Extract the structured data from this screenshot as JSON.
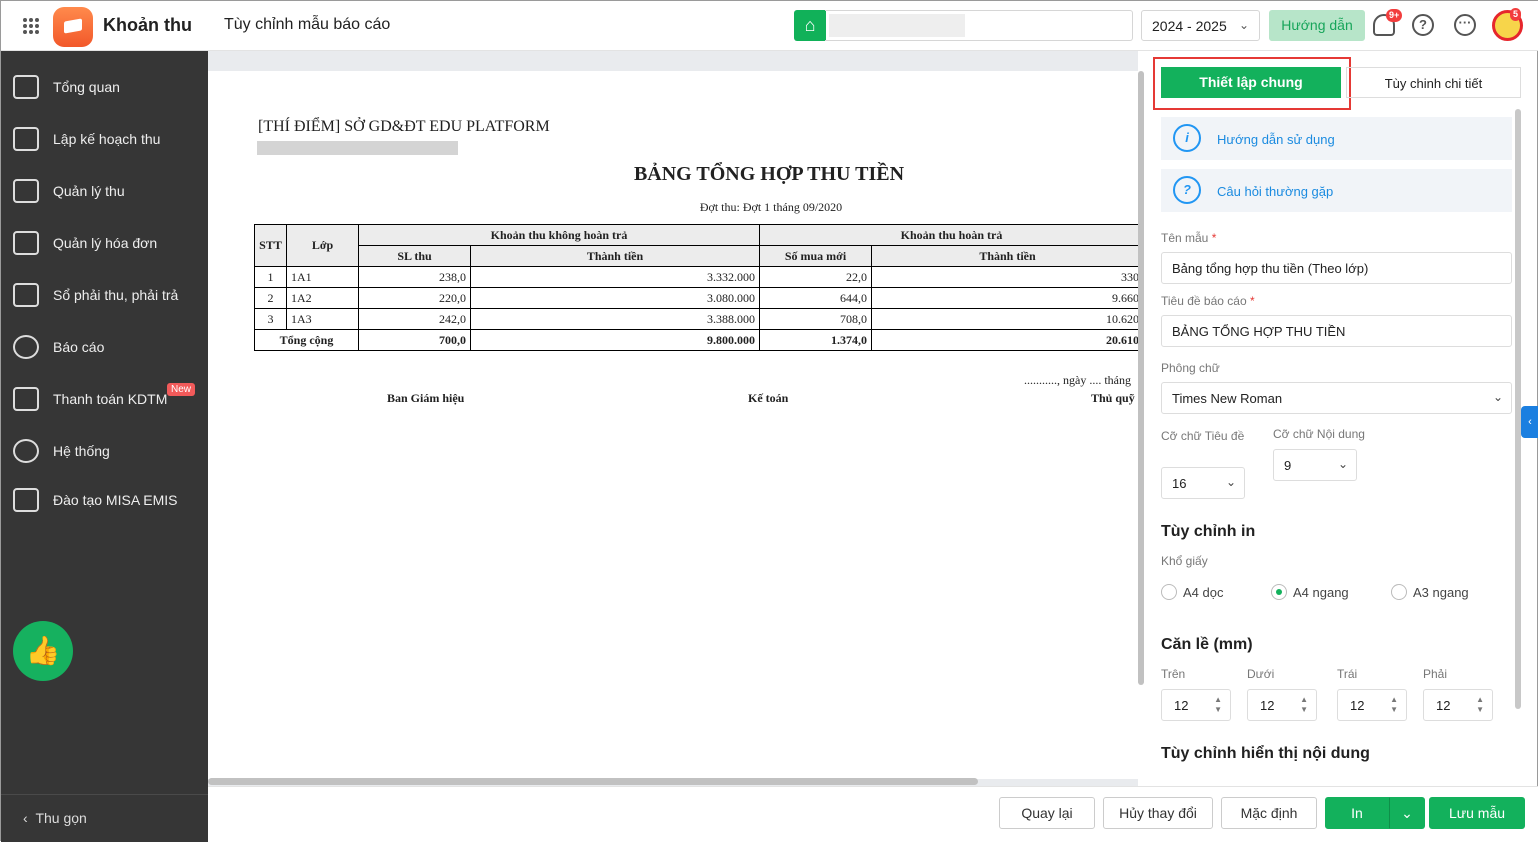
{
  "header": {
    "app_title": "Khoản thu",
    "page_title": "Tùy chỉnh mẫu báo cáo",
    "year": "2024 - 2025",
    "guide": "Hướng dẫn",
    "notif_badge": "9+",
    "avatar_badge": "5"
  },
  "sidebar": {
    "items": [
      {
        "label": "Tổng quan"
      },
      {
        "label": "Lập kế hoạch thu"
      },
      {
        "label": "Quản lý thu"
      },
      {
        "label": "Quản lý hóa đơn"
      },
      {
        "label": "Sổ phải thu, phải trả"
      },
      {
        "label": "Báo cáo"
      },
      {
        "label": "Thanh toán KDTM",
        "badge": "New"
      },
      {
        "label": "Hệ thống"
      },
      {
        "label": "Đào tạo MISA EMIS"
      }
    ],
    "collapse": "Thu gọn"
  },
  "report": {
    "org": "[THÍ ĐIỂM] SỞ GD&ĐT EDU PLATFORM",
    "title": "BẢNG TỔNG HỢP THU TIỀN",
    "period": "Đợt thu: Đợt 1 tháng 09/2020",
    "headers": {
      "stt": "STT",
      "lop": "Lớp",
      "group1": "Khoản thu không hoàn trả",
      "group2": "Khoản thu hoàn trả",
      "sl_thu": "SL thu",
      "thanh_tien1": "Thành tiền",
      "so_mua_moi": "Số mua mới",
      "thanh_tien2": "Thành tiền"
    },
    "rows": [
      [
        "1",
        "1A1",
        "238,0",
        "3.332.000",
        "22,0",
        "330"
      ],
      [
        "2",
        "1A2",
        "220,0",
        "3.080.000",
        "644,0",
        "9.660"
      ],
      [
        "3",
        "1A3",
        "242,0",
        "3.388.000",
        "708,0",
        "10.620"
      ]
    ],
    "total": {
      "label": "Tổng cộng",
      "sl_thu": "700,0",
      "thanh_tien1": "9.800.000",
      "so_mua_moi": "1.374,0",
      "thanh_tien2": "20.610"
    },
    "date_line": "..........., ngày .... tháng",
    "signers": [
      "Ban Giám hiệu",
      "Kế toán",
      "Thủ quỹ"
    ]
  },
  "panel": {
    "tab_general": "Thiết lập chung",
    "tab_detail": "Tùy chinh chi tiết",
    "help": "Hướng dẫn sử dụng",
    "faq": "Câu hỏi thường gặp",
    "template_name_label": "Tên mẫu",
    "template_name": "Bảng tổng hợp thu tiền (Theo lớp)",
    "report_title_label": "Tiêu đề báo cáo",
    "report_title": "BẢNG TỔNG HỢP THU TIỀN",
    "font_label": "Phông chữ",
    "font": "Times New Roman",
    "title_size_label": "Cỡ chữ Tiêu đề",
    "title_size": "16",
    "content_size_label": "Cỡ chữ Nội dung",
    "content_size": "9",
    "print_heading": "Tùy chỉnh in",
    "paper_label": "Khổ giấy",
    "paper_options": [
      "A4 dọc",
      "A4 ngang",
      "A3 ngang"
    ],
    "paper_selected": "A4 ngang",
    "margin_heading": "Căn lề (mm)",
    "margins": [
      {
        "label": "Trên",
        "value": "12"
      },
      {
        "label": "Dưới",
        "value": "12"
      },
      {
        "label": "Trái",
        "value": "12"
      },
      {
        "label": "Phải",
        "value": "12"
      }
    ],
    "display_heading": "Tùy chỉnh hiển thị nội dung"
  },
  "footer": {
    "back": "Quay lại",
    "discard": "Hủy thay đổi",
    "default": "Mặc định",
    "print": "In",
    "save": "Lưu mẫu"
  }
}
